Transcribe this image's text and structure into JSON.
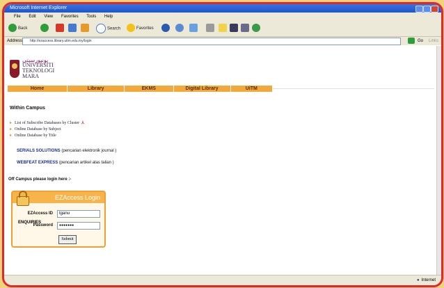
{
  "window": {
    "title": "Microsoft Internet Explorer"
  },
  "menu": [
    "File",
    "Edit",
    "View",
    "Favorites",
    "Tools",
    "Help"
  ],
  "toolbar": {
    "back": "Back",
    "search": "Search",
    "favorites": "Favorites"
  },
  "address": {
    "label": "Address",
    "url": "http://ezaccess.library.uitm.edu.my/login",
    "go": "Go",
    "links": "Links"
  },
  "logo": {
    "jawi": "ﯾﻮﻧﯿﻮﺭﺳﯿﺘﻲ",
    "line1": "UNIVERSITI",
    "line2": "TEKNOLOGI",
    "line3": "MARA"
  },
  "nav": [
    "Home",
    "Library",
    "EKMS",
    "Digital Library",
    "UiTM"
  ],
  "within": {
    "title": "Within Campus",
    "items": [
      "List of Subscribe Databases by Cluster",
      "Online Database by Subject",
      "Online Database by Title"
    ],
    "pdf_icon": "pdf-icon"
  },
  "links": [
    {
      "name": "SERIALS SOLUTIONS",
      "desc": "(pencarian elektronik journal )"
    },
    {
      "name": "WEBFEAT EXPRESS",
      "desc": "(pencarian artikel atas talian )"
    }
  ],
  "offcampus": {
    "title": "Off Campus please login here :-"
  },
  "login": {
    "title": "EZAccess Login",
    "id_label": "EZAccess ID",
    "id_value": "tganu",
    "pw_label": "Password",
    "pw_value": "●●●●●●●",
    "submit": "Submit"
  },
  "enquiries": "ENQUIRIES",
  "status": {
    "zone": "Internet"
  }
}
